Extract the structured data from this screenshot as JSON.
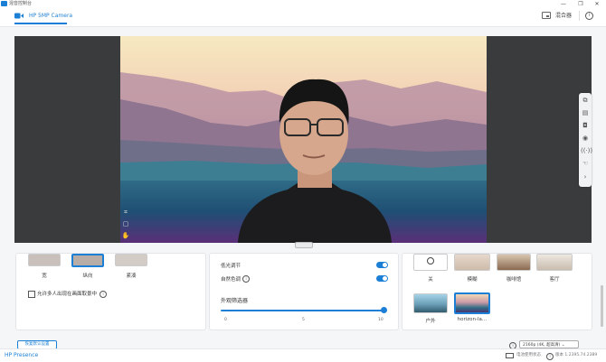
{
  "window": {
    "app_name": "混音控制台",
    "controls": {
      "minimize": "—",
      "restore": "❐",
      "close": "✕"
    }
  },
  "tabbar": {
    "camera_tab": "HP 5MP Camera",
    "mixer_label": "混合器",
    "info_icon": "info-icon"
  },
  "preview": {
    "left_tools": [
      "crop-icon",
      "frame-icon",
      "hand-icon"
    ],
    "right_tools": [
      "pip-icon",
      "picture-icon",
      "camera-icon",
      "record-icon",
      "broadcast-icon",
      "gesture-icon",
      "chevron-right-icon"
    ]
  },
  "framing": {
    "options": [
      {
        "label": "宽"
      },
      {
        "label": "纵向"
      },
      {
        "label": "紧凑"
      }
    ],
    "selected_index": 1,
    "multi_person_label": "允许多人出现在画面取景中"
  },
  "adjust": {
    "low_light_label": "低光调节",
    "low_light_on": true,
    "natural_color_label": "自然色调",
    "natural_color_on": true,
    "appearance_filter_label": "外观筛选器",
    "slider_value": 10,
    "slider_min": 0,
    "slider_max": 10,
    "ticks": [
      "0",
      "5",
      "10"
    ]
  },
  "background": {
    "options": [
      {
        "label": "关",
        "icon": "none-icon"
      },
      {
        "label": "模糊"
      },
      {
        "label": "咖啡馆"
      },
      {
        "label": "客厅"
      },
      {
        "label": "户外"
      },
      {
        "label": "horizon-la…"
      }
    ],
    "selected_index": 5
  },
  "footer": {
    "advanced_link": "恢复默认设置",
    "resolution": "2160p (4K, 超高清)",
    "resolution_arrow": "⌄"
  },
  "statusbar": {
    "brand": "HP Presence",
    "power_status": "电池使用状态",
    "version": "版本 1.2395.74.2389"
  },
  "colors": {
    "accent": "#1c7fd6",
    "preview_bg": "#3a3b3d"
  }
}
